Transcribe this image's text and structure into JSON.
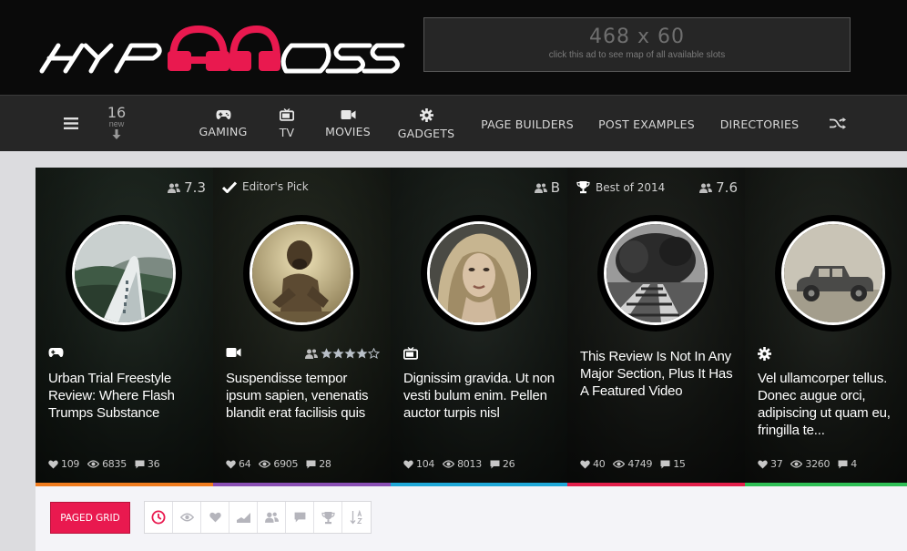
{
  "ad": {
    "size": "468 x 60",
    "note": "click this ad to see map of all available slots"
  },
  "nav": {
    "new_count": "16",
    "new_label": "new",
    "items": [
      {
        "label": "GAMING",
        "icon": "gamepad-icon"
      },
      {
        "label": "TV",
        "icon": "tv-icon"
      },
      {
        "label": "MOVIES",
        "icon": "video-camera-icon"
      },
      {
        "label": "GADGETS",
        "icon": "gear-icon"
      },
      {
        "label": "PAGE BUILDERS"
      },
      {
        "label": "POST EXAMPLES"
      },
      {
        "label": "DIRECTORIES"
      }
    ]
  },
  "cards": [
    {
      "badge": "",
      "rating": "7.3",
      "category_icon": "gamepad-icon",
      "title": "Urban Trial Freestyle Review: Where Flash Trumps Substance",
      "likes": "109",
      "views": "6835",
      "comments": "36",
      "accent": "#f07c1e"
    },
    {
      "badge": "Editor's Pick",
      "rating": "",
      "stars": 4,
      "category_icon": "video-camera-icon",
      "title": "Suspendisse tempor ipsum sapien, venenatis blandit erat facilisis quis",
      "likes": "64",
      "views": "6905",
      "comments": "28",
      "accent": "#8a4fb5"
    },
    {
      "badge": "",
      "rating": "B",
      "category_icon": "tv-icon",
      "title": "Dignissim gravida. Ut non vesti bulum enim. Pellen auctor turpis nisl",
      "likes": "104",
      "views": "8013",
      "comments": "26",
      "accent": "#1fa8d8"
    },
    {
      "badge": "Best of 2014",
      "rating": "7.6",
      "category_icon": "",
      "title": "This Review Is Not In Any Major Section, Plus It Has A Featured Video",
      "likes": "40",
      "views": "4749",
      "comments": "15",
      "accent": "#e31f4b"
    },
    {
      "badge": "",
      "rating": "",
      "category_icon": "gear-icon",
      "title": "Vel ullamcorper tellus. Donec augue orci, adipiscing ut quam eu, fringilla te...",
      "likes": "37",
      "views": "3260",
      "comments": "4",
      "accent": "#2fbf56"
    }
  ],
  "grid": {
    "paged_label": "PAGED GRID",
    "filters": [
      "clock-icon",
      "eye-icon",
      "heart-icon",
      "chart-icon",
      "users-icon",
      "comment-icon",
      "trophy-icon",
      "sort-alpha-icon"
    ]
  },
  "colors": {
    "brand": "#e9194f",
    "header": "#0a0a0a",
    "nav": "#262626"
  }
}
